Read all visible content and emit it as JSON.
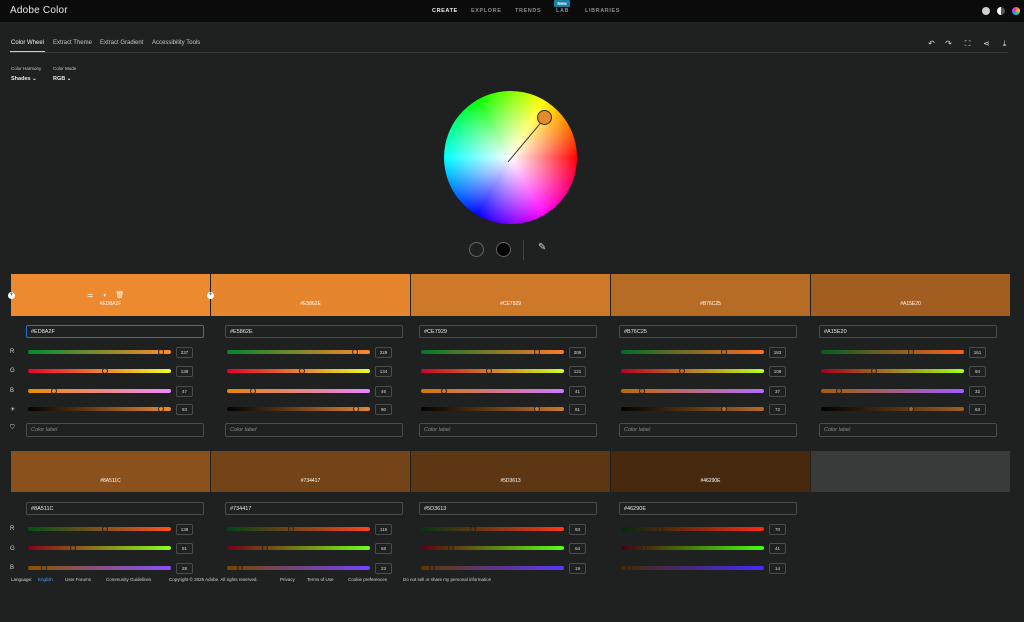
{
  "app": {
    "title": "Adobe Color"
  },
  "topnav": {
    "items": [
      {
        "label": "CREATE",
        "active": true
      },
      {
        "label": "EXPLORE",
        "active": false
      },
      {
        "label": "TRENDS",
        "active": false
      },
      {
        "label": "LAB",
        "active": false
      },
      {
        "label": "LIBRARIES",
        "active": false
      }
    ],
    "badge": "New"
  },
  "subnav": {
    "tabs": [
      "Color Wheel",
      "Extract Theme",
      "Extract Gradient",
      "Accessibility Tools"
    ]
  },
  "controls": {
    "harmony_label": "Color Harmony",
    "harmony_value": "Shades",
    "mode_label": "Color Mode",
    "mode_value": "RGB"
  },
  "row_labels": [
    "R",
    "G",
    "B"
  ],
  "placeholder": "Color label",
  "swatches_top": [
    {
      "hex": "#ED8A2F",
      "color": "#ED8A2F",
      "r": 237,
      "g": 138,
      "b": 47,
      "br": 93
    },
    {
      "hex": "#E5862E",
      "color": "#E5862E",
      "r": 229,
      "g": 134,
      "b": 46,
      "br": 90
    },
    {
      "hex": "#CE7929",
      "color": "#CE7929",
      "r": 206,
      "g": 121,
      "b": 41,
      "br": 81
    },
    {
      "hex": "#B76C25",
      "color": "#B76C25",
      "r": 183,
      "g": 108,
      "b": 37,
      "br": 72
    },
    {
      "hex": "#A15E20",
      "color": "#A15E20",
      "r": 161,
      "g": 94,
      "b": 32,
      "br": 63
    }
  ],
  "swatches_bottom": [
    {
      "hex": "#8A511C",
      "color": "#8A511C",
      "r": 138,
      "g": 81,
      "b": 28
    },
    {
      "hex": "#734417",
      "color": "#734417",
      "r": 115,
      "g": 68,
      "b": 23
    },
    {
      "hex": "#5D3613",
      "color": "#5D3613",
      "r": 93,
      "g": 54,
      "b": 19
    },
    {
      "hex": "#46290E",
      "color": "#46290E",
      "r": 70,
      "g": 41,
      "b": 14
    }
  ],
  "footer": {
    "language_label": "Language:",
    "language_value": "English",
    "links": [
      "User Forums",
      "Community Guidelines",
      "Copyright © 2025 Adobe. All rights reserved.",
      "Privacy",
      "Terms of Use",
      "Cookie preferences",
      "Do not sell or share my personal information"
    ]
  }
}
